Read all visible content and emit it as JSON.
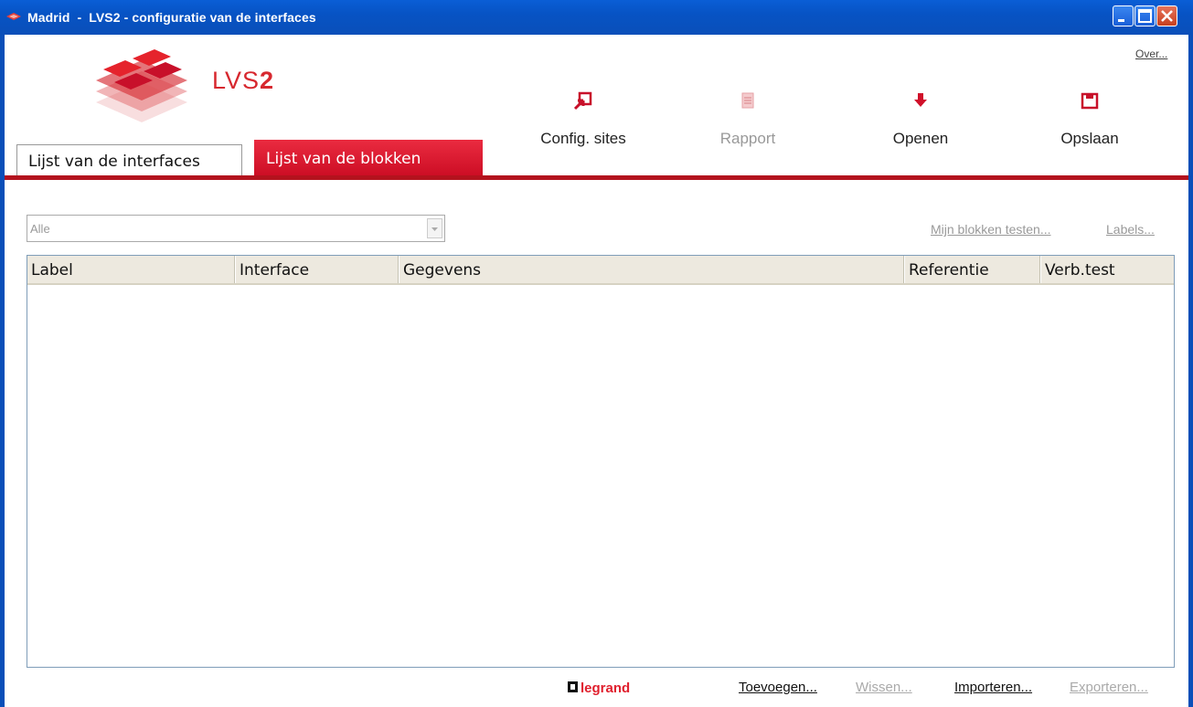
{
  "window": {
    "title": "Madrid  -  LVS2 - configuratie van de interfaces"
  },
  "brand": {
    "product_prefix": "LVS",
    "product_suffix": "2",
    "accent": "#d7282f",
    "footer_logo": "legrand"
  },
  "header": {
    "about_link": "Over..."
  },
  "toolbar": {
    "config_sites": {
      "label": "Config. sites",
      "icon": "config-sites-icon"
    },
    "rapport": {
      "label": "Rapport",
      "icon": "report-icon"
    },
    "openen": {
      "label": "Openen",
      "icon": "open-arrow-icon"
    },
    "opslaan": {
      "label": "Opslaan",
      "icon": "save-icon"
    }
  },
  "tabs": {
    "interfaces": "Lijst van de interfaces",
    "blokken": "Lijst van de blokken"
  },
  "filter": {
    "selected": "Alle"
  },
  "actions": {
    "test_blocks": "Mijn blokken testen...",
    "labels": "Labels..."
  },
  "table": {
    "columns": [
      "Label",
      "Interface",
      "Gegevens",
      "Referentie",
      "Verb.test"
    ],
    "rows": []
  },
  "footer": {
    "add": "Toevoegen...",
    "delete": "Wissen...",
    "import": "Importeren...",
    "export": "Exporteren..."
  }
}
